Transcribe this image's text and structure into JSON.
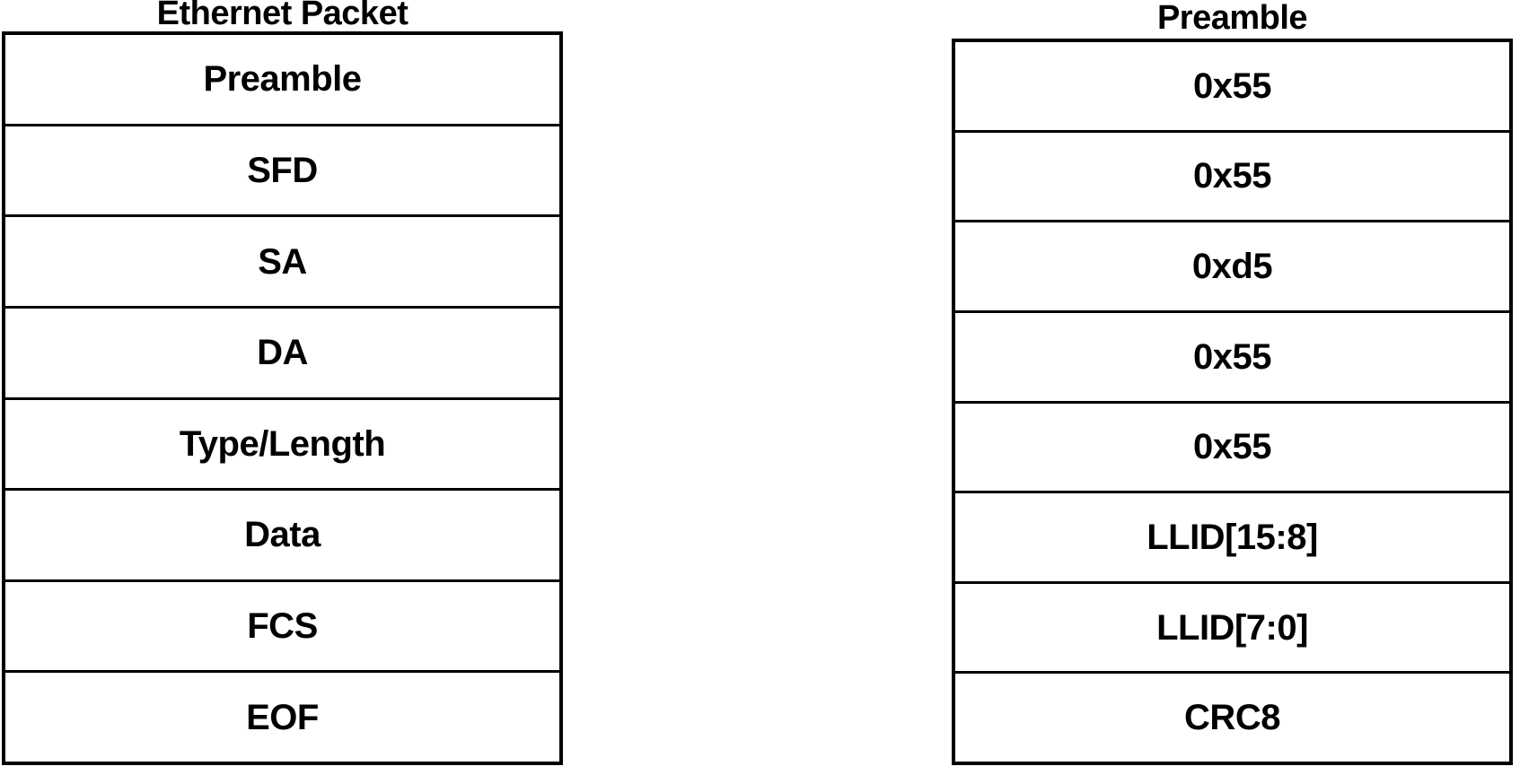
{
  "figure": {
    "type": "packet-structure-diagram",
    "background_color": "#ffffff",
    "line_color": "#000000"
  },
  "panels": [
    {
      "id": "ethernet-packet",
      "title": "Ethernet Packet",
      "fields": [
        {
          "label": "Preamble"
        },
        {
          "label": "SFD"
        },
        {
          "label": "SA"
        },
        {
          "label": "DA"
        },
        {
          "label": "Type/Length"
        },
        {
          "label": "Data"
        },
        {
          "label": "FCS"
        },
        {
          "label": "EOF"
        }
      ]
    },
    {
      "id": "preamble",
      "title": "Preamble",
      "fields": [
        {
          "label": "0x55"
        },
        {
          "label": "0x55"
        },
        {
          "label": "0xd5"
        },
        {
          "label": "0x55"
        },
        {
          "label": "0x55"
        },
        {
          "label": "LLID[15:8]"
        },
        {
          "label": "LLID[7:0]"
        },
        {
          "label": "CRC8"
        }
      ]
    }
  ]
}
